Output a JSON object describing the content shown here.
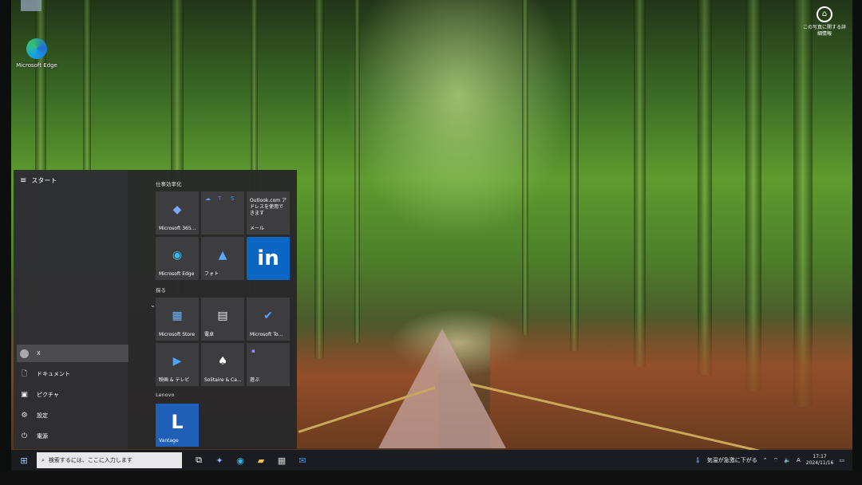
{
  "desktop": {
    "icons": [
      {
        "name": "edge",
        "label": "Microsoft Edge"
      }
    ],
    "corner": {
      "label_line1": "この写真に関する詳",
      "label_line2": "細情報"
    }
  },
  "start_menu": {
    "header": "スタート",
    "rail": {
      "user": "X",
      "documents": "ドキュメント",
      "pictures": "ピクチャ",
      "settings": "設定",
      "power": "電源"
    },
    "groups": [
      {
        "title": "仕事効率化"
      },
      {
        "title": "探る"
      },
      {
        "title": "Lenovo"
      }
    ],
    "tiles": {
      "m365": "Microsoft 365...",
      "outlook_text": "Outlook.com アドレスを使用できます",
      "mail": "メール",
      "edge": "Microsoft Edge",
      "photos": "フォト",
      "linkedin": "in",
      "store": "Microsoft Store",
      "calc": "電卓",
      "todo": "Microsoft To...",
      "movies": "映画 & テレビ",
      "solitaire": "Solitaire & Ca...",
      "play": "遊ぶ",
      "vantage": "Vantage"
    }
  },
  "taskbar": {
    "search_placeholder": "検索するには、ここに入力します",
    "weather": "気温が急激に下がる",
    "ime": "A",
    "time": "17:17",
    "date": "2024/11/16"
  },
  "colors": {
    "linkedin": "#0a66c2",
    "vantage": "#1f5fb8",
    "taskbar": "#1b1c22"
  }
}
